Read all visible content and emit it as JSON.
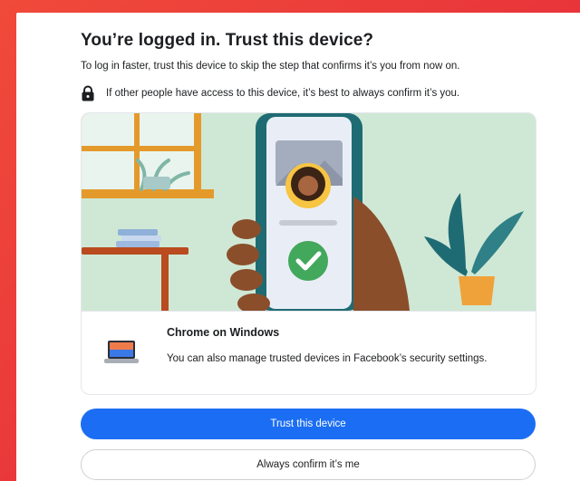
{
  "dialog": {
    "title": "You’re logged in. Trust this device?",
    "subtitle": "To log in faster, trust this device to skip the step that confirms it’s you from now on.",
    "notice": "If other people have access to this device, it’s best to always confirm it’s you."
  },
  "device": {
    "name": "Chrome on Windows",
    "note": "You can also manage trusted devices in Facebook’s security settings."
  },
  "actions": {
    "trust_label": "Trust this device",
    "confirm_label": "Always confirm it’s me"
  },
  "colors": {
    "background": "#ee3f3a",
    "primary_button": "#1b6ef3",
    "illustration_bg": "#cfe8d5",
    "phone": "#1f6b73",
    "check": "#42a85c"
  },
  "icons": {
    "notice": "lock-icon",
    "device": "laptop-icon",
    "verified": "checkmark-icon"
  }
}
